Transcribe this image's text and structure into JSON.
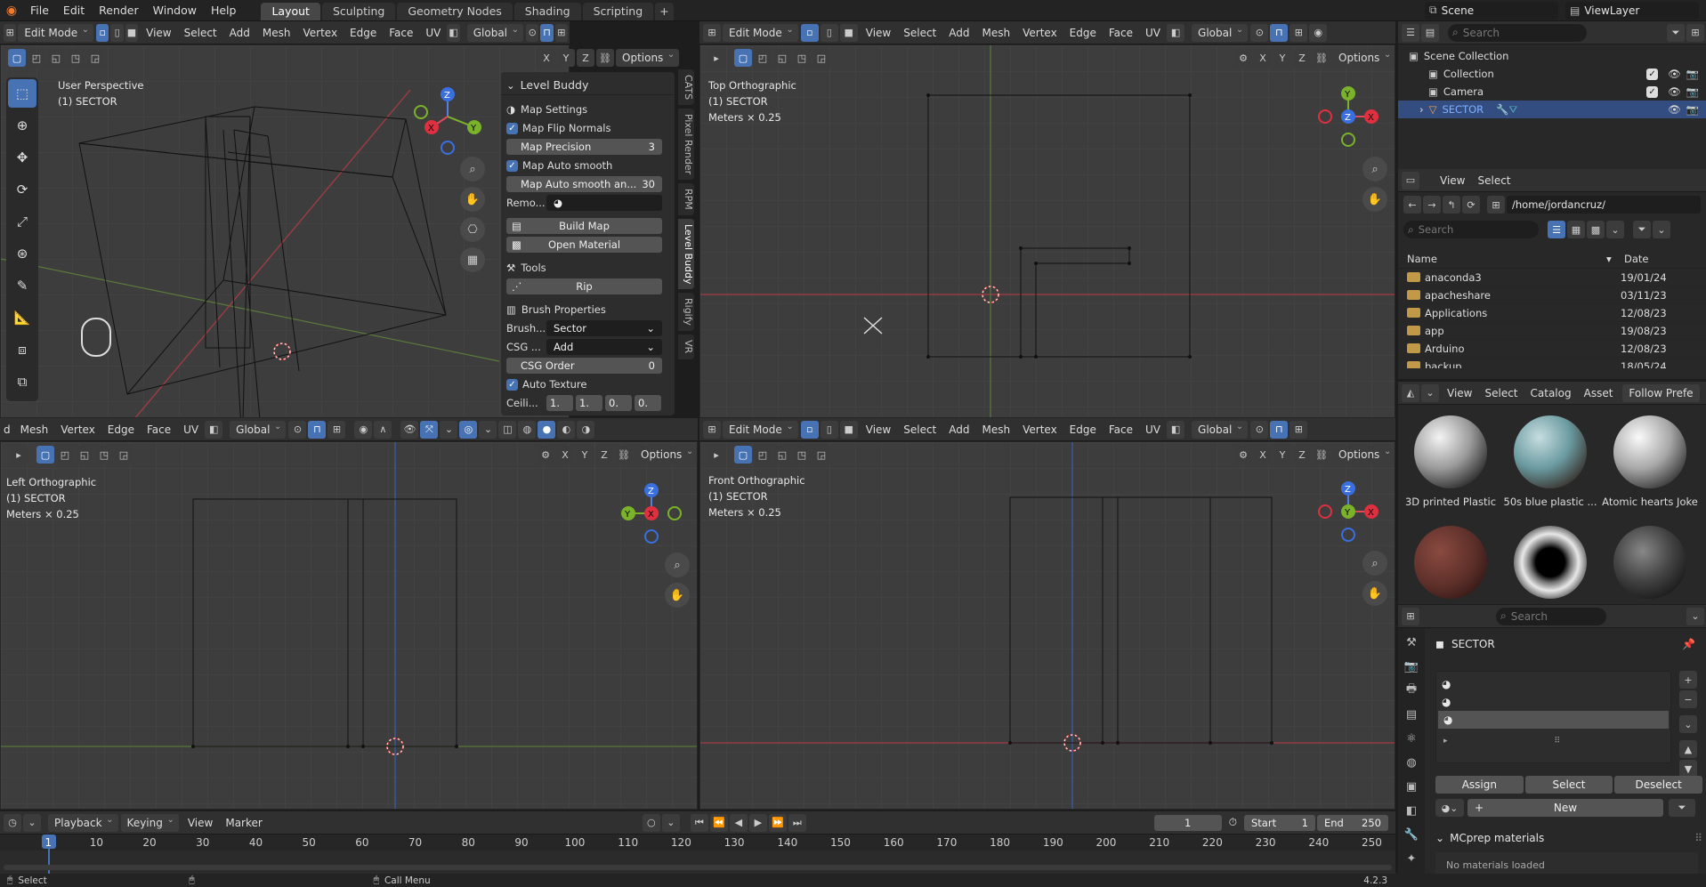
{
  "menu": {
    "items": [
      "File",
      "Edit",
      "Render",
      "Window",
      "Help"
    ]
  },
  "workspaces": [
    "Layout",
    "Sculpting",
    "Geometry Nodes",
    "Shading",
    "Scripting"
  ],
  "active_workspace": "Layout",
  "scene": {
    "scene_name": "Scene",
    "view_layer": "ViewLayer"
  },
  "viewport_header": {
    "mode": "Edit Mode",
    "menus": [
      "View",
      "Select",
      "Add",
      "Mesh",
      "Vertex",
      "Edge",
      "Face",
      "UV"
    ],
    "orientation": "Global",
    "options": "Options",
    "axes": [
      "X",
      "Y",
      "Z"
    ]
  },
  "viewport_bl_header": {
    "menus": [
      "Mesh",
      "Vertex",
      "Edge",
      "Face",
      "UV"
    ],
    "cut": "d",
    "orientation": "Global"
  },
  "viewports": {
    "tl": {
      "title": "User Perspective",
      "object": "(1) SECTOR"
    },
    "tr": {
      "title": "Top Orthographic",
      "object": "(1) SECTOR",
      "scale": "Meters × 0.25"
    },
    "bl": {
      "title": "Left Orthographic",
      "object": "(1) SECTOR",
      "scale": "Meters × 0.25"
    },
    "br": {
      "title": "Front Orthographic",
      "object": "(1) SECTOR",
      "scale": "Meters × 0.25"
    }
  },
  "gizmo_labels": {
    "x": "X",
    "y": "Y",
    "z": "Z"
  },
  "level_buddy": {
    "title": "Level Buddy",
    "map_settings": "Map Settings",
    "flip_normals": "Map Flip Normals",
    "precision_label": "Map Precision",
    "precision_value": "3",
    "auto_smooth": "Map Auto smooth",
    "auto_smooth_angle_label": "Map Auto smooth an...",
    "auto_smooth_angle_value": "30",
    "remove_label": "Remo...",
    "build_map": "Build Map",
    "open_material": "Open Material",
    "tools": "Tools",
    "rip": "Rip",
    "brush_props": "Brush Properties",
    "brush_label": "Brush...",
    "brush_value": "Sector",
    "csg_label": "CSG ...",
    "csg_value": "Add",
    "csg_order_label": "CSG Order",
    "csg_order_value": "0",
    "auto_texture": "Auto Texture",
    "ceiling_label": "Ceili...",
    "ceiling_values": [
      "1.",
      "1.",
      "0.",
      "0."
    ]
  },
  "side_tabs": [
    "CATS",
    "Pixel Render",
    "RPM",
    "Level Buddy",
    "Rigify",
    "VR"
  ],
  "outliner": {
    "search_placeholder": "Search",
    "items": [
      {
        "label": "Scene Collection",
        "indent": 0
      },
      {
        "label": "Collection",
        "indent": 1
      },
      {
        "label": "Camera",
        "indent": 1
      },
      {
        "label": "SECTOR",
        "indent": 1,
        "selected": true
      }
    ]
  },
  "file_browser": {
    "menus": [
      "View",
      "Select"
    ],
    "path": "/home/jordancruz/",
    "search_placeholder": "Search",
    "col_name": "Name",
    "col_date": "Date",
    "rows": [
      {
        "name": "anaconda3",
        "date": "19/01/24"
      },
      {
        "name": "apacheshare",
        "date": "03/11/23"
      },
      {
        "name": "Applications",
        "date": "12/08/23"
      },
      {
        "name": "app",
        "date": "19/08/23"
      },
      {
        "name": "Arduino",
        "date": "12/08/23"
      },
      {
        "name": "backup",
        "date": "18/05/24"
      }
    ]
  },
  "asset_browser": {
    "menus": [
      "View",
      "Select",
      "Catalog",
      "Asset"
    ],
    "follow": "Follow Prefe",
    "materials": [
      "3D printed Plastic",
      "50s blue plastic ...",
      "Atomic hearts Joke",
      "",
      "",
      ""
    ]
  },
  "properties": {
    "search_placeholder": "Search",
    "object_name": "SECTOR",
    "assign": "Assign",
    "select": "Select",
    "deselect": "Deselect",
    "new": "New",
    "mcprep": "MCprep materials",
    "no_materials": "No materials loaded"
  },
  "timeline": {
    "menus": [
      "Playback",
      "Keying",
      "View",
      "Marker"
    ],
    "current_frame": "1",
    "start_label": "Start",
    "start": "1",
    "end_label": "End",
    "end": "250",
    "ticks": [
      "1",
      "10",
      "20",
      "30",
      "40",
      "50",
      "60",
      "70",
      "80",
      "90",
      "100",
      "110",
      "120",
      "130",
      "140",
      "150",
      "160",
      "170",
      "180",
      "190",
      "200",
      "210",
      "220",
      "230",
      "240",
      "250"
    ]
  },
  "statusbar": {
    "select": "Select",
    "call_menu": "Call Menu",
    "version": "4.2.3"
  }
}
